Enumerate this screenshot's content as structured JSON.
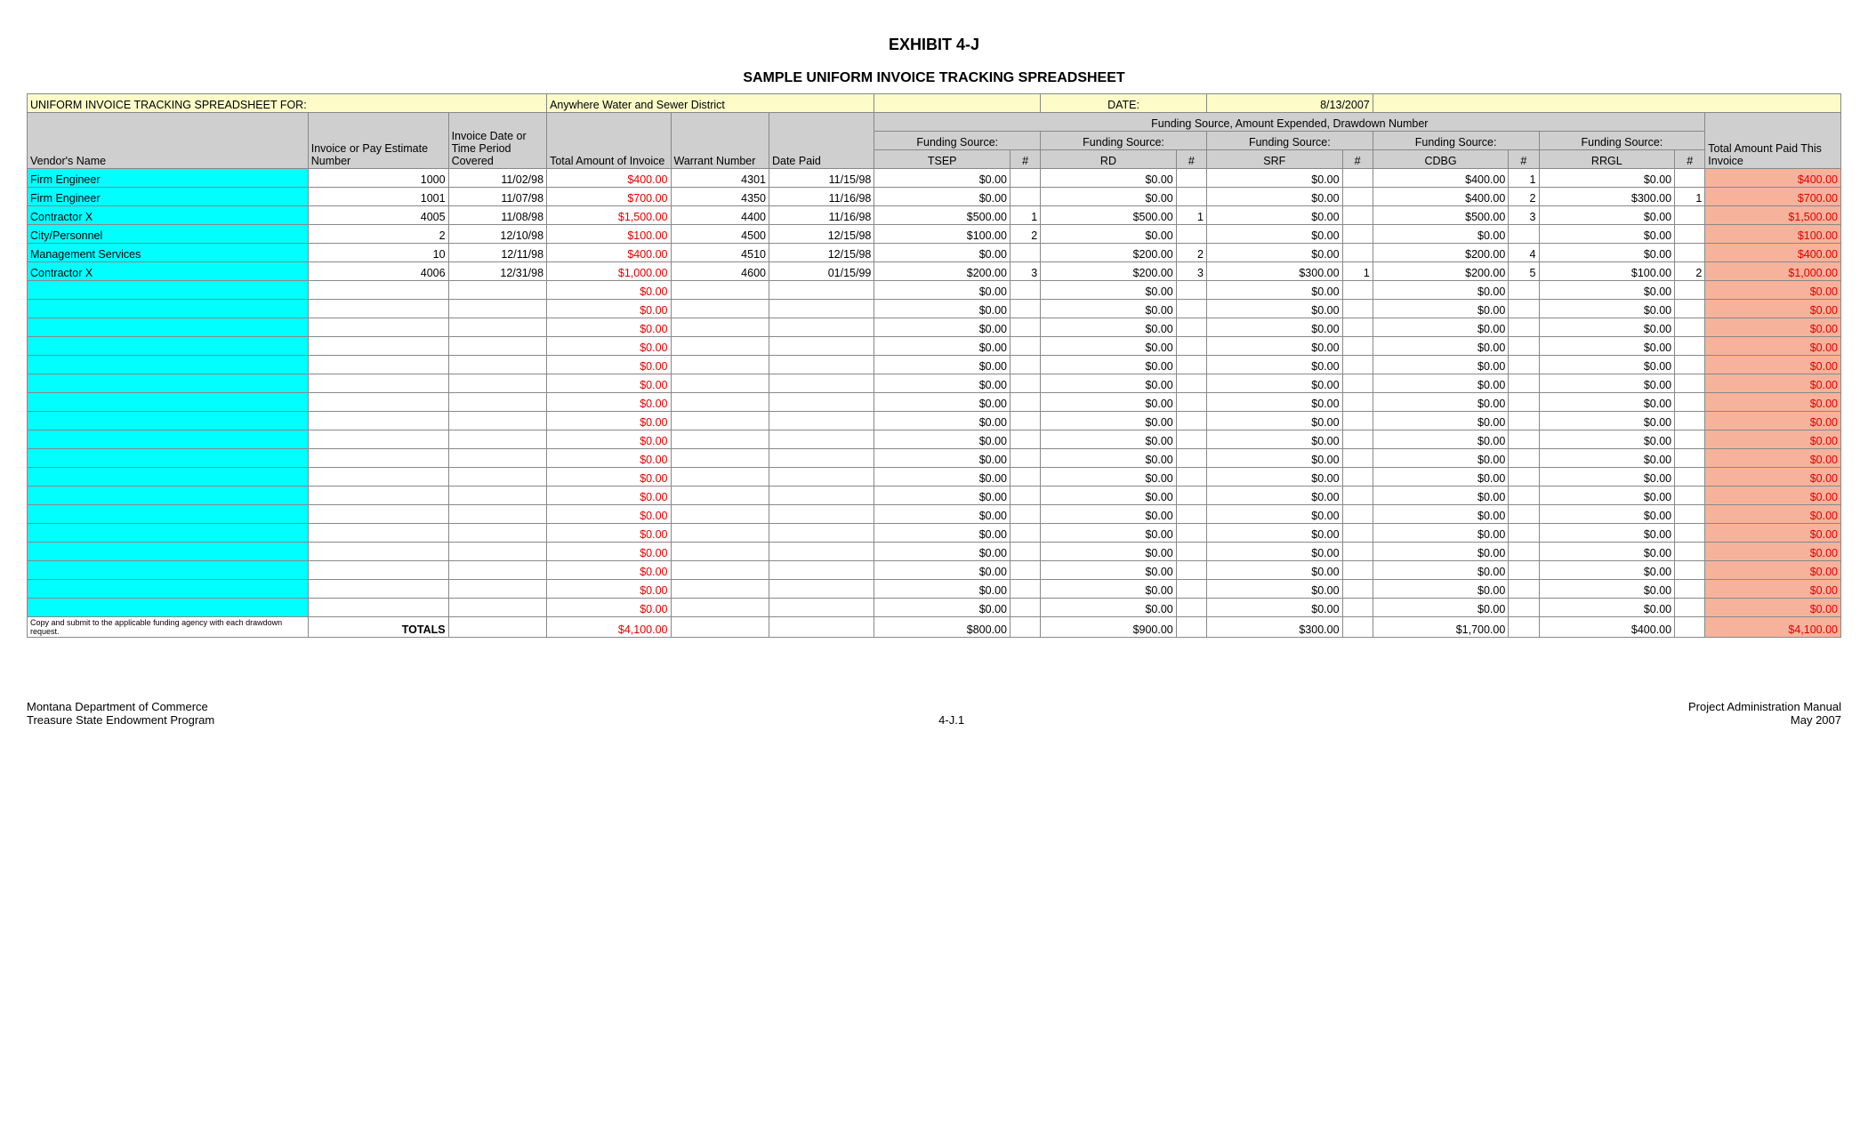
{
  "title": "EXHIBIT 4-J",
  "subtitle": "SAMPLE UNIFORM INVOICE TRACKING SPREADSHEET",
  "header_label": "UNIFORM INVOICE TRACKING SPREADSHEET FOR:",
  "district": "Anywhere Water and Sewer District",
  "date_label": "DATE:",
  "date_value": "8/13/2007",
  "cols": {
    "vendor": "Vendor's Name",
    "invnum": "Invoice or Pay Estimate Number",
    "period": "Invoice Date or Time Period Covered",
    "total": "Total Amount of Invoice",
    "warrant": "Warrant Number",
    "datepaid": "Date Paid",
    "funding_group": "Funding Source, Amount Expended, Drawdown Number",
    "fs_label": "Funding Source:",
    "tsep": "TSEP",
    "rd": "RD",
    "srf": "SRF",
    "cdbg": "CDBG",
    "rrgl": "RRGL",
    "hash": "#",
    "paid": "Total Amount Paid This Invoice"
  },
  "rows": [
    {
      "vendor": "Firm Engineer",
      "inv": "1000",
      "period": "11/02/98",
      "total": "$400.00",
      "warrant": "4301",
      "datepaid": "11/15/98",
      "tsep": "$0.00",
      "tn": "",
      "rd": "$0.00",
      "rn": "",
      "srf": "$0.00",
      "sn": "",
      "cdbg": "$400.00",
      "cn": "1",
      "rrgl": "$0.00",
      "gn": "",
      "paid": "$400.00"
    },
    {
      "vendor": "Firm Engineer",
      "inv": "1001",
      "period": "11/07/98",
      "total": "$700.00",
      "warrant": "4350",
      "datepaid": "11/16/98",
      "tsep": "$0.00",
      "tn": "",
      "rd": "$0.00",
      "rn": "",
      "srf": "$0.00",
      "sn": "",
      "cdbg": "$400.00",
      "cn": "2",
      "rrgl": "$300.00",
      "gn": "1",
      "paid": "$700.00"
    },
    {
      "vendor": "Contractor X",
      "inv": "4005",
      "period": "11/08/98",
      "total": "$1,500.00",
      "warrant": "4400",
      "datepaid": "11/16/98",
      "tsep": "$500.00",
      "tn": "1",
      "rd": "$500.00",
      "rn": "1",
      "srf": "$0.00",
      "sn": "",
      "cdbg": "$500.00",
      "cn": "3",
      "rrgl": "$0.00",
      "gn": "",
      "paid": "$1,500.00"
    },
    {
      "vendor": "City/Personnel",
      "inv": "2",
      "period": "12/10/98",
      "total": "$100.00",
      "warrant": "4500",
      "datepaid": "12/15/98",
      "tsep": "$100.00",
      "tn": "2",
      "rd": "$0.00",
      "rn": "",
      "srf": "$0.00",
      "sn": "",
      "cdbg": "$0.00",
      "cn": "",
      "rrgl": "$0.00",
      "gn": "",
      "paid": "$100.00"
    },
    {
      "vendor": "Management Services",
      "inv": "10",
      "period": "12/11/98",
      "total": "$400.00",
      "warrant": "4510",
      "datepaid": "12/15/98",
      "tsep": "$0.00",
      "tn": "",
      "rd": "$200.00",
      "rn": "2",
      "srf": "$0.00",
      "sn": "",
      "cdbg": "$200.00",
      "cn": "4",
      "rrgl": "$0.00",
      "gn": "",
      "paid": "$400.00"
    },
    {
      "vendor": "Contractor X",
      "inv": "4006",
      "period": "12/31/98",
      "total": "$1,000.00",
      "warrant": "4600",
      "datepaid": "01/15/99",
      "tsep": "$200.00",
      "tn": "3",
      "rd": "$200.00",
      "rn": "3",
      "srf": "$300.00",
      "sn": "1",
      "cdbg": "$200.00",
      "cn": "5",
      "rrgl": "$100.00",
      "gn": "2",
      "paid": "$1,000.00"
    },
    {
      "vendor": "",
      "inv": "",
      "period": "",
      "total": "$0.00",
      "warrant": "",
      "datepaid": "",
      "tsep": "$0.00",
      "tn": "",
      "rd": "$0.00",
      "rn": "",
      "srf": "$0.00",
      "sn": "",
      "cdbg": "$0.00",
      "cn": "",
      "rrgl": "$0.00",
      "gn": "",
      "paid": "$0.00"
    },
    {
      "vendor": "",
      "inv": "",
      "period": "",
      "total": "$0.00",
      "warrant": "",
      "datepaid": "",
      "tsep": "$0.00",
      "tn": "",
      "rd": "$0.00",
      "rn": "",
      "srf": "$0.00",
      "sn": "",
      "cdbg": "$0.00",
      "cn": "",
      "rrgl": "$0.00",
      "gn": "",
      "paid": "$0.00"
    },
    {
      "vendor": "",
      "inv": "",
      "period": "",
      "total": "$0.00",
      "warrant": "",
      "datepaid": "",
      "tsep": "$0.00",
      "tn": "",
      "rd": "$0.00",
      "rn": "",
      "srf": "$0.00",
      "sn": "",
      "cdbg": "$0.00",
      "cn": "",
      "rrgl": "$0.00",
      "gn": "",
      "paid": "$0.00"
    },
    {
      "vendor": "",
      "inv": "",
      "period": "",
      "total": "$0.00",
      "warrant": "",
      "datepaid": "",
      "tsep": "$0.00",
      "tn": "",
      "rd": "$0.00",
      "rn": "",
      "srf": "$0.00",
      "sn": "",
      "cdbg": "$0.00",
      "cn": "",
      "rrgl": "$0.00",
      "gn": "",
      "paid": "$0.00"
    },
    {
      "vendor": "",
      "inv": "",
      "period": "",
      "total": "$0.00",
      "warrant": "",
      "datepaid": "",
      "tsep": "$0.00",
      "tn": "",
      "rd": "$0.00",
      "rn": "",
      "srf": "$0.00",
      "sn": "",
      "cdbg": "$0.00",
      "cn": "",
      "rrgl": "$0.00",
      "gn": "",
      "paid": "$0.00"
    },
    {
      "vendor": "",
      "inv": "",
      "period": "",
      "total": "$0.00",
      "warrant": "",
      "datepaid": "",
      "tsep": "$0.00",
      "tn": "",
      "rd": "$0.00",
      "rn": "",
      "srf": "$0.00",
      "sn": "",
      "cdbg": "$0.00",
      "cn": "",
      "rrgl": "$0.00",
      "gn": "",
      "paid": "$0.00"
    },
    {
      "vendor": "",
      "inv": "",
      "period": "",
      "total": "$0.00",
      "warrant": "",
      "datepaid": "",
      "tsep": "$0.00",
      "tn": "",
      "rd": "$0.00",
      "rn": "",
      "srf": "$0.00",
      "sn": "",
      "cdbg": "$0.00",
      "cn": "",
      "rrgl": "$0.00",
      "gn": "",
      "paid": "$0.00"
    },
    {
      "vendor": "",
      "inv": "",
      "period": "",
      "total": "$0.00",
      "warrant": "",
      "datepaid": "",
      "tsep": "$0.00",
      "tn": "",
      "rd": "$0.00",
      "rn": "",
      "srf": "$0.00",
      "sn": "",
      "cdbg": "$0.00",
      "cn": "",
      "rrgl": "$0.00",
      "gn": "",
      "paid": "$0.00"
    },
    {
      "vendor": "",
      "inv": "",
      "period": "",
      "total": "$0.00",
      "warrant": "",
      "datepaid": "",
      "tsep": "$0.00",
      "tn": "",
      "rd": "$0.00",
      "rn": "",
      "srf": "$0.00",
      "sn": "",
      "cdbg": "$0.00",
      "cn": "",
      "rrgl": "$0.00",
      "gn": "",
      "paid": "$0.00"
    },
    {
      "vendor": "",
      "inv": "",
      "period": "",
      "total": "$0.00",
      "warrant": "",
      "datepaid": "",
      "tsep": "$0.00",
      "tn": "",
      "rd": "$0.00",
      "rn": "",
      "srf": "$0.00",
      "sn": "",
      "cdbg": "$0.00",
      "cn": "",
      "rrgl": "$0.00",
      "gn": "",
      "paid": "$0.00"
    },
    {
      "vendor": "",
      "inv": "",
      "period": "",
      "total": "$0.00",
      "warrant": "",
      "datepaid": "",
      "tsep": "$0.00",
      "tn": "",
      "rd": "$0.00",
      "rn": "",
      "srf": "$0.00",
      "sn": "",
      "cdbg": "$0.00",
      "cn": "",
      "rrgl": "$0.00",
      "gn": "",
      "paid": "$0.00"
    },
    {
      "vendor": "",
      "inv": "",
      "period": "",
      "total": "$0.00",
      "warrant": "",
      "datepaid": "",
      "tsep": "$0.00",
      "tn": "",
      "rd": "$0.00",
      "rn": "",
      "srf": "$0.00",
      "sn": "",
      "cdbg": "$0.00",
      "cn": "",
      "rrgl": "$0.00",
      "gn": "",
      "paid": "$0.00"
    },
    {
      "vendor": "",
      "inv": "",
      "period": "",
      "total": "$0.00",
      "warrant": "",
      "datepaid": "",
      "tsep": "$0.00",
      "tn": "",
      "rd": "$0.00",
      "rn": "",
      "srf": "$0.00",
      "sn": "",
      "cdbg": "$0.00",
      "cn": "",
      "rrgl": "$0.00",
      "gn": "",
      "paid": "$0.00"
    },
    {
      "vendor": "",
      "inv": "",
      "period": "",
      "total": "$0.00",
      "warrant": "",
      "datepaid": "",
      "tsep": "$0.00",
      "tn": "",
      "rd": "$0.00",
      "rn": "",
      "srf": "$0.00",
      "sn": "",
      "cdbg": "$0.00",
      "cn": "",
      "rrgl": "$0.00",
      "gn": "",
      "paid": "$0.00"
    },
    {
      "vendor": "",
      "inv": "",
      "period": "",
      "total": "$0.00",
      "warrant": "",
      "datepaid": "",
      "tsep": "$0.00",
      "tn": "",
      "rd": "$0.00",
      "rn": "",
      "srf": "$0.00",
      "sn": "",
      "cdbg": "$0.00",
      "cn": "",
      "rrgl": "$0.00",
      "gn": "",
      "paid": "$0.00"
    },
    {
      "vendor": "",
      "inv": "",
      "period": "",
      "total": "$0.00",
      "warrant": "",
      "datepaid": "",
      "tsep": "$0.00",
      "tn": "",
      "rd": "$0.00",
      "rn": "",
      "srf": "$0.00",
      "sn": "",
      "cdbg": "$0.00",
      "cn": "",
      "rrgl": "$0.00",
      "gn": "",
      "paid": "$0.00"
    },
    {
      "vendor": "",
      "inv": "",
      "period": "",
      "total": "$0.00",
      "warrant": "",
      "datepaid": "",
      "tsep": "$0.00",
      "tn": "",
      "rd": "$0.00",
      "rn": "",
      "srf": "$0.00",
      "sn": "",
      "cdbg": "$0.00",
      "cn": "",
      "rrgl": "$0.00",
      "gn": "",
      "paid": "$0.00"
    },
    {
      "vendor": "",
      "inv": "",
      "period": "",
      "total": "$0.00",
      "warrant": "",
      "datepaid": "",
      "tsep": "$0.00",
      "tn": "",
      "rd": "$0.00",
      "rn": "",
      "srf": "$0.00",
      "sn": "",
      "cdbg": "$0.00",
      "cn": "",
      "rrgl": "$0.00",
      "gn": "",
      "paid": "$0.00"
    }
  ],
  "totals": {
    "footnote": "Copy and submit to the applicable funding agency with each drawdown request.",
    "label": "TOTALS",
    "total": "$4,100.00",
    "tsep": "$800.00",
    "rd": "$900.00",
    "srf": "$300.00",
    "cdbg": "$1,700.00",
    "rrgl": "$400.00",
    "paid": "$4,100.00"
  },
  "footer": {
    "left1": "Montana Department of Commerce",
    "left2": "Treasure State Endowment Program",
    "mid": "4-J.1",
    "right1": "Project Administration Manual",
    "right2": "May 2007"
  }
}
